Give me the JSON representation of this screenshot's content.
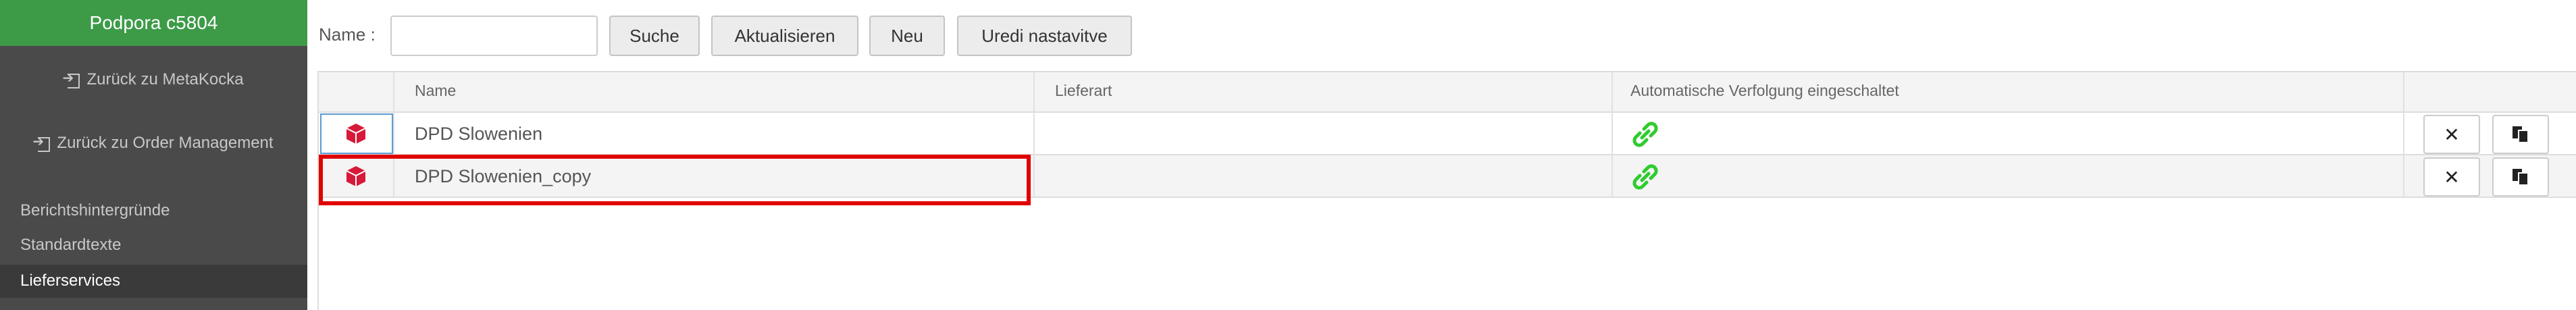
{
  "sidebar": {
    "title": "Podpora c5804",
    "links": [
      {
        "label": "Zurück zu MetaKocka",
        "icon": "sign-out-icon"
      },
      {
        "label": "Zurück zu Order Management",
        "icon": "sign-out-icon"
      }
    ],
    "items": [
      {
        "label": "Berichtshintergründe"
      },
      {
        "label": "Standardtexte"
      },
      {
        "label": "Lieferservices"
      }
    ],
    "active_item": "Lieferservices"
  },
  "toolbar": {
    "name_label": "Name :",
    "name_value": "",
    "search_label": "Suche",
    "refresh_label": "Aktualisieren",
    "new_label": "Neu",
    "edit_settings_label": "Uredi nastavitve"
  },
  "grid": {
    "columns": [
      "",
      "Name",
      "Lieferart",
      "Automatische Verfolgung eingeschaltet",
      ""
    ],
    "rows": [
      {
        "name": "DPD Slowenien",
        "delivery_type": "",
        "auto_tracking_icon": "link-icon"
      },
      {
        "name": "DPD Slowenien_copy",
        "delivery_type": "",
        "auto_tracking_icon": "link-icon"
      }
    ],
    "row_actions": {
      "delete_symbol": "✕",
      "copy_icon": "copy-icon"
    }
  },
  "colors": {
    "sidebar_header": "#3d9b48",
    "sidebar_bg": "#4a4a4a",
    "package_icon": "#d7193a",
    "link_icon": "#2ecc2e",
    "highlight": "#e00000"
  }
}
